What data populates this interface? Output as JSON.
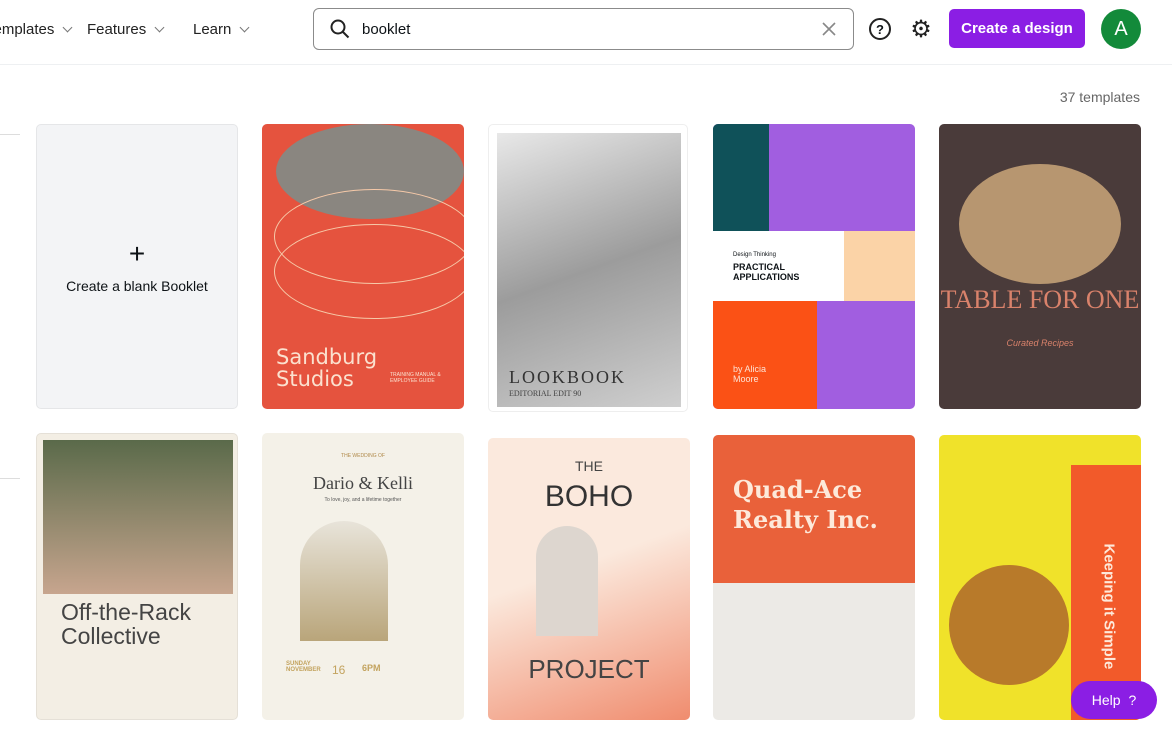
{
  "nav": {
    "items": [
      {
        "label": "Templates"
      },
      {
        "label": "Features"
      },
      {
        "label": "Learn"
      }
    ]
  },
  "search": {
    "value": "booklet",
    "icon": "search-icon",
    "clear_icon": "close-icon"
  },
  "header": {
    "help_icon": "question-circle-icon",
    "settings_icon": "gear-icon",
    "create_label": "Create a design",
    "avatar_initial": "A",
    "accent": "#8b1ee4"
  },
  "results": {
    "count": "37 templates"
  },
  "blank": {
    "plus": "+",
    "label": "Create a blank Booklet"
  },
  "templates": [
    {
      "title": "Sandburg Studios",
      "subtitle": "TRAINING MANUAL & EMPLOYEE GUIDE",
      "color": "#e5533e"
    },
    {
      "title": "LOOKBOOK",
      "subtitle": "EDITORIAL EDIT 90",
      "color": "#cfcfcf"
    },
    {
      "kicker": "Design Thinking",
      "title": "PRACTICAL APPLICATIONS",
      "author": "by Alicia Moore",
      "color": "#a15ee0"
    },
    {
      "title": "TABLE FOR ONE",
      "subtitle": "Curated Recipes",
      "color": "#4a3b3a"
    },
    {
      "title": "Off-the-Rack Collective",
      "color": "#f3eee4"
    },
    {
      "kicker": "THE WEDDING OF",
      "title": "Dario & Kelli",
      "subtitle": "To love, joy, and a lifetime together",
      "day": "SUNDAY NOVEMBER",
      "date": "16",
      "time": "6PM",
      "color": "#f4f1e8"
    },
    {
      "pre": "THE",
      "title": "BOHO",
      "post": "PROJECT",
      "color": "#fbe4d8"
    },
    {
      "title": "Quad-Ace Realty Inc.",
      "color": "#e9613a"
    },
    {
      "title": "Keeping it Simple",
      "color": "#f0e22a"
    }
  ],
  "help": {
    "label": "Help",
    "icon": "?"
  }
}
